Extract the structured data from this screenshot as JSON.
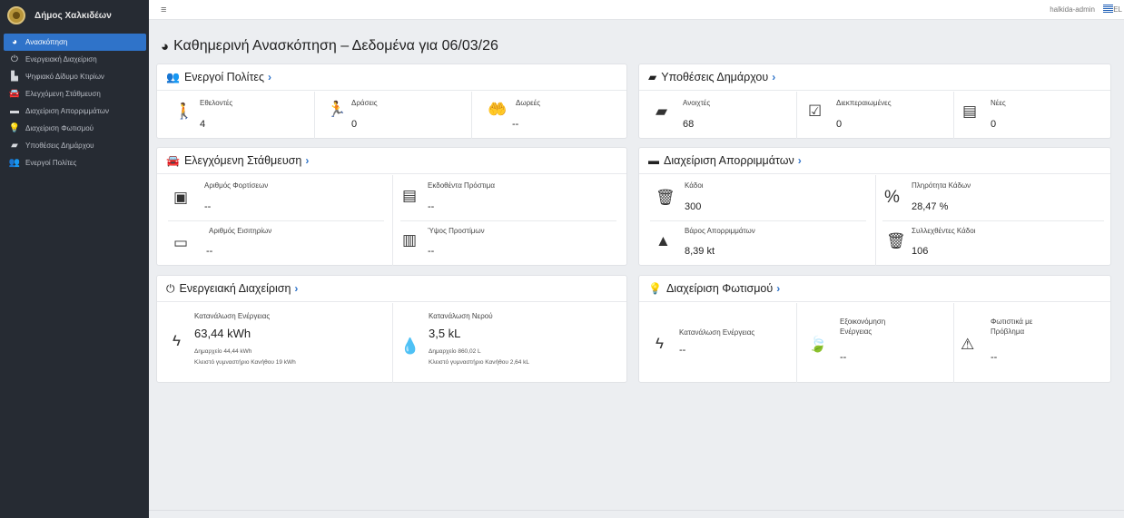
{
  "brand": {
    "name": "Δήμος Χαλκιδέων"
  },
  "sidebar": {
    "items": [
      {
        "label": "Ανασκόπηση",
        "icon": "dashboard-icon",
        "glyph": "◕",
        "active": true
      },
      {
        "label": "Ενεργειακή Διαχείριση",
        "icon": "power-icon",
        "glyph": "⏻",
        "active": false
      },
      {
        "label": "Ψηφιακό Δίδυμο Κτιρίων",
        "icon": "building-icon",
        "glyph": "▙",
        "active": false
      },
      {
        "label": "Ελεγχόμενη Στάθμευση",
        "icon": "car-icon",
        "glyph": "🚘",
        "active": false
      },
      {
        "label": "Διαχείριση Απορριμμάτων",
        "icon": "dumpster-icon",
        "glyph": "▬",
        "active": false
      },
      {
        "label": "Διαχείριση Φωτισμού",
        "icon": "lightbulb-icon",
        "glyph": "💡",
        "active": false
      },
      {
        "label": "Υποθέσεις Δημάρχου",
        "icon": "folder-icon",
        "glyph": "▰",
        "active": false
      },
      {
        "label": "Ενεργοί Πολίτες",
        "icon": "users-icon",
        "glyph": "👥",
        "active": false
      }
    ]
  },
  "topbar": {
    "user": "halkida-admin",
    "lang": "EL"
  },
  "page": {
    "title": "Καθημερινή Ανασκόπηση – Δεδομένα για 06/03/26"
  },
  "cards": {
    "citizens": {
      "title": "Ενεργοί Πολίτες",
      "volunteers": {
        "label": "Εθελοντές",
        "value": "4"
      },
      "actions": {
        "label": "Δράσεις",
        "value": "0"
      },
      "donations": {
        "label": "Δωρεές",
        "value": "--"
      }
    },
    "mayor": {
      "title": "Υποθέσεις Δημάρχου",
      "open": {
        "label": "Ανοιχτές",
        "value": "68"
      },
      "completed": {
        "label": "Διεκπεραιωμένες",
        "value": "0"
      },
      "new": {
        "label": "Νέες",
        "value": "0"
      }
    },
    "parking": {
      "title": "Ελεγχόμενη Στάθμευση",
      "charges": {
        "label": "Αριθμός Φορτίσεων",
        "value": "--"
      },
      "fines": {
        "label": "Εκδοθέντα Πρόστιμα",
        "value": "--"
      },
      "tickets": {
        "label": "Αριθμός Εισιτηρίων",
        "value": "--"
      },
      "fines_amount": {
        "label": "Ύψος Προστίμων",
        "value": "--"
      }
    },
    "waste": {
      "title": "Διαχείριση Απορριμμάτων",
      "bins": {
        "label": "Κάδοι",
        "value": "300"
      },
      "fill": {
        "label": "Πληρότητα Κάδων",
        "value": "28,47 %"
      },
      "weight": {
        "label": "Βάρος Απορριμμάτων",
        "value": "8,39 kt"
      },
      "collected": {
        "label": "Συλλεχθέντες Κάδοι",
        "value": "106"
      }
    },
    "energy": {
      "title": "Ενεργειακή Διαχείριση",
      "power": {
        "label": "Κατανάλωση Ενέργειας",
        "value": "63,44 kWh",
        "line1": "Δημαρχείο 44,44 kWh",
        "line2": "Κλειστό γυμναστήριο Κανήθου 19 kWh"
      },
      "water": {
        "label": "Κατανάλωση Νερού",
        "value": "3,5 kL",
        "line1": "Δημαρχείο 860,02 L",
        "line2": "Κλειστό γυμναστήριο Κανήθου 2,64 kL"
      }
    },
    "lighting": {
      "title": "Διαχείριση Φωτισμού",
      "consumption": {
        "label": "Κατανάλωση Ενέργειας",
        "value": "--"
      },
      "saving": {
        "label": "Εξοικονόμηση",
        "label2": "Ενέργειας",
        "value": "--"
      },
      "problems": {
        "label": "Φωτιστικά με",
        "label2": "Πρόβλημα",
        "value": "--"
      }
    }
  }
}
